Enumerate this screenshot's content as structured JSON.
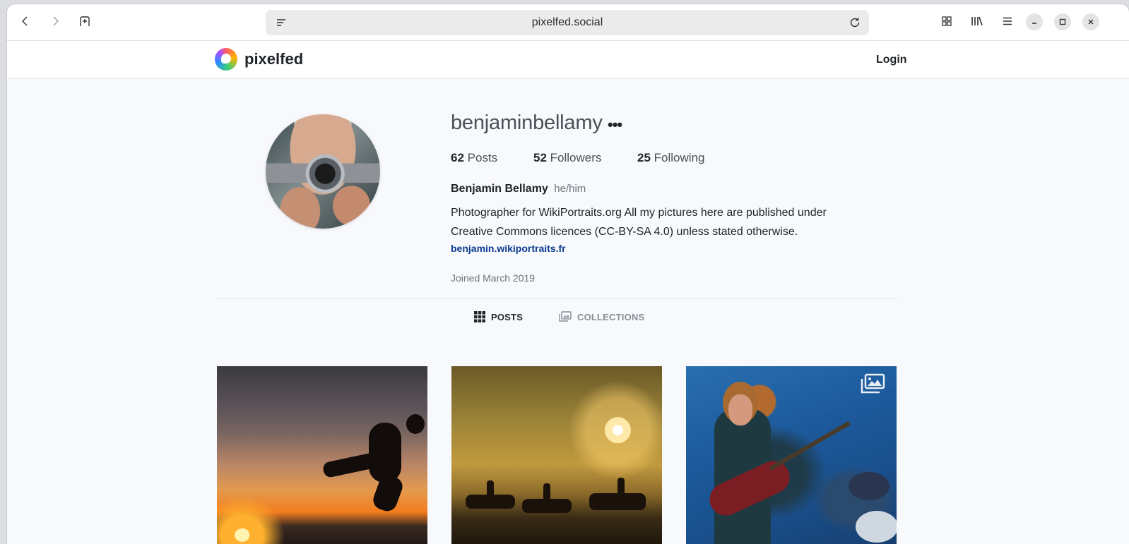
{
  "browser": {
    "url": "pixelfed.social",
    "icons": [
      "back-icon",
      "forward-icon",
      "new-tab-icon",
      "page-menu-icon",
      "reload-icon",
      "overview-icon",
      "library-icon",
      "menu-icon",
      "minimize-icon",
      "maximize-icon",
      "close-icon"
    ]
  },
  "site": {
    "logo_text": "pixelfed",
    "login_label": "Login"
  },
  "profile": {
    "username": "benjaminbellamy",
    "more_label": "•••",
    "stats": {
      "posts_count": "62",
      "posts_label": "Posts",
      "followers_count": "52",
      "followers_label": "Followers",
      "following_count": "25",
      "following_label": "Following"
    },
    "display_name": "Benjamin Bellamy",
    "pronouns": "he/him",
    "bio_line1": "Photographer for WikiPortraits.org All my pictures here are published under",
    "bio_line2": "Creative Commons licences (CC-BY-SA 4.0) unless stated otherwise.",
    "website": "benjamin.wikiportraits.fr",
    "joined": "Joined March 2019"
  },
  "tabs": {
    "posts_label": "POSTS",
    "collections_label": "COLLECTIONS"
  },
  "posts": [
    {
      "subject": "silhouette jumping kick at sunset on beach"
    },
    {
      "subject": "horse riders silhouetted at sunset on beach"
    },
    {
      "subject": "guitarist performing on stage with blue light",
      "multi_image": true
    }
  ]
}
